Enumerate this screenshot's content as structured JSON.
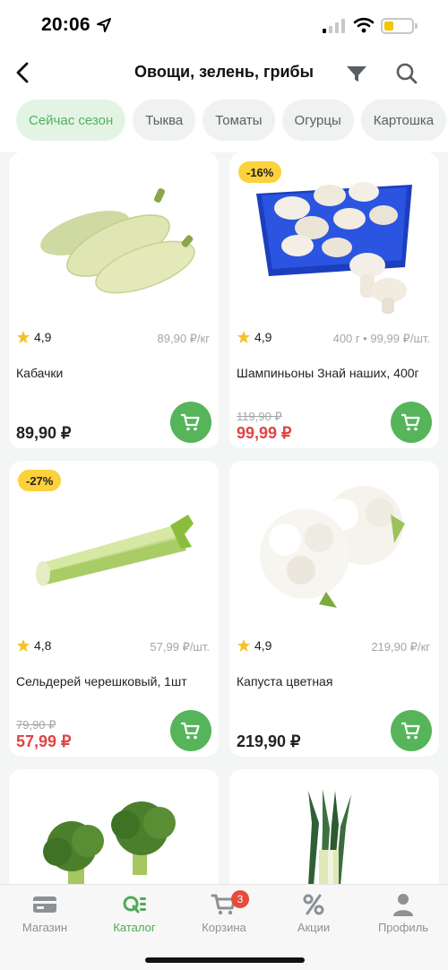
{
  "status": {
    "time": "20:06"
  },
  "header": {
    "title": "Овощи, зелень, грибы"
  },
  "chips": [
    {
      "label": "Сейчас сезон",
      "active": true
    },
    {
      "label": "Тыква"
    },
    {
      "label": "Томаты"
    },
    {
      "label": "Огурцы"
    },
    {
      "label": "Картошка"
    }
  ],
  "products": [
    {
      "name": "Кабачки",
      "rating": "4,9",
      "unit_price": "89,90 ₽/кг",
      "price": "89,90 ₽",
      "old_price": "",
      "badge": ""
    },
    {
      "name": "Шампиньоны Знай наших, 400г",
      "rating": "4,9",
      "unit_price": "400 г • 99,99 ₽/шт.",
      "price": "99,99 ₽",
      "old_price": "119,90 ₽",
      "badge": "-16%"
    },
    {
      "name": "Сельдерей черешковый, 1шт",
      "rating": "4,8",
      "unit_price": "57,99 ₽/шт.",
      "price": "57,99 ₽",
      "old_price": "79,90 ₽",
      "badge": "-27%"
    },
    {
      "name": "Капуста цветная",
      "rating": "4,9",
      "unit_price": "219,90 ₽/кг",
      "price": "219,90 ₽",
      "old_price": "",
      "badge": ""
    }
  ],
  "tabs": [
    {
      "label": "Магазин",
      "icon": "card-icon"
    },
    {
      "label": "Каталог",
      "icon": "catalog-icon",
      "active": true
    },
    {
      "label": "Корзина",
      "icon": "cart-icon",
      "badge": "3"
    },
    {
      "label": "Акции",
      "icon": "percent-icon"
    },
    {
      "label": "Профиль",
      "icon": "profile-icon"
    }
  ],
  "colors": {
    "accent": "#56b45b",
    "sale": "#e14343",
    "badge": "#fbd23b"
  }
}
